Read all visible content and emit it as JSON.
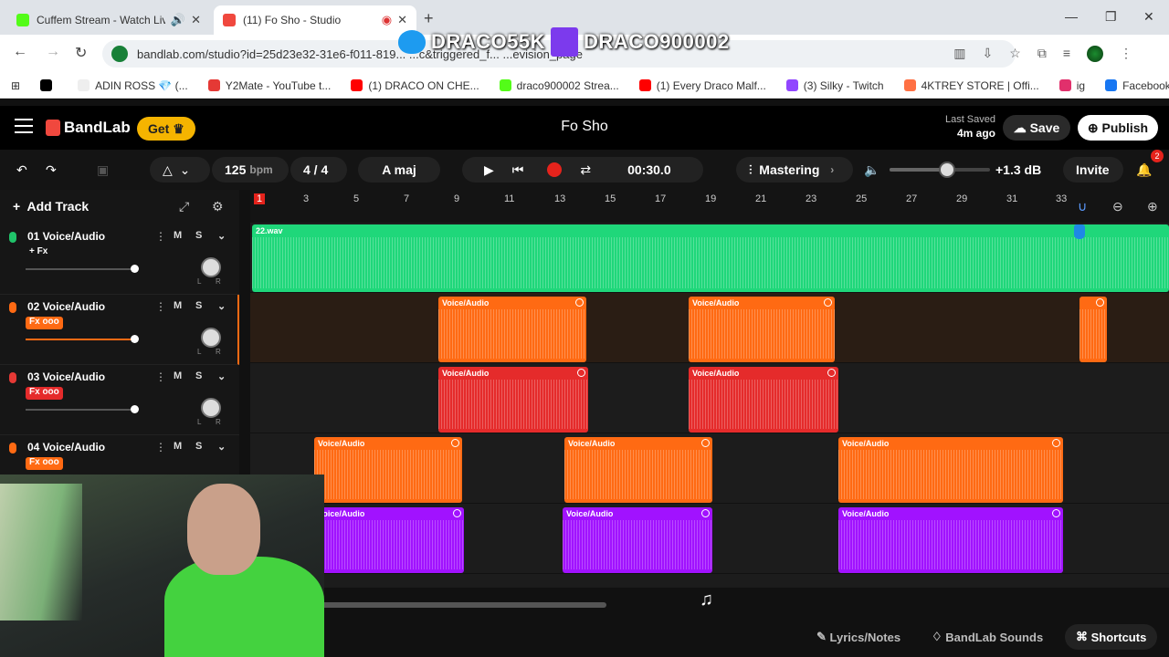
{
  "browser": {
    "tabs": [
      {
        "title": "Cuffem Stream - Watch Live",
        "favicon_color": "#53fc18",
        "state": "inactive"
      },
      {
        "title": "(11) Fo Sho - Studio",
        "favicon_color": "#f0483e",
        "state": "active"
      }
    ],
    "url": "bandlab.com/studio?id=25d23e32-31e6-f011-819... ...c&triggered_f... ...evision_page",
    "bookmarks": [
      {
        "label": "ADIN ROSS 💎 (...",
        "icon_color": "#000000"
      },
      {
        "label": "Y2Mate - YouTube t...",
        "icon_color": "#e53935"
      },
      {
        "label": "(1) DRACO ON CHE...",
        "icon_color": "#ff0000"
      },
      {
        "label": "draco900002 Strea...",
        "icon_color": "#53fc18"
      },
      {
        "label": "(1) Every Draco Malf...",
        "icon_color": "#ff0000"
      },
      {
        "label": "(3) Silky - Twitch",
        "icon_color": "#9146ff"
      },
      {
        "label": "4KTREY STORE | Offi...",
        "icon_color": "#ff7043"
      },
      {
        "label": "ig",
        "icon_color": "#e1306c"
      },
      {
        "label": "Facebook",
        "icon_color": "#1877f2"
      }
    ]
  },
  "overlay": {
    "twitter": "DRACO55K",
    "twitch": "DRACO900002"
  },
  "app": {
    "brand": "BandLab",
    "get_label": "Get",
    "song_title": "Fo Sho",
    "last_saved_label": "Last Saved",
    "last_saved_time": "4m ago",
    "save_label": "Save",
    "publish_label": "Publish"
  },
  "toolbar": {
    "bpm": "125",
    "bpm_unit": "bpm",
    "time_sig": "4 / 4",
    "key": "A maj",
    "time": "00:30.0",
    "mastering": "Mastering",
    "gain": "+1.3 dB",
    "invite": "Invite",
    "notifications": "2",
    "volume_level": 0.55
  },
  "tracks_panel": {
    "add_track": "Add Track",
    "tracks": [
      {
        "name": "01 Voice/Audio",
        "fx": "+ Fx",
        "mic_color": "#20c36a"
      },
      {
        "name": "02 Voice/Audio",
        "fx": "Fx ooo",
        "mic_color": "#ff6a13"
      },
      {
        "name": "03 Voice/Audio",
        "fx": "Fx ooo",
        "mic_color": "#e53935"
      },
      {
        "name": "04 Voice/Audio",
        "fx": "Fx ooo",
        "mic_color": "#ff6a13"
      }
    ],
    "mute": "M",
    "solo": "S"
  },
  "ruler": [
    "1",
    "3",
    "5",
    "7",
    "9",
    "11",
    "13",
    "15",
    "17",
    "19",
    "21",
    "23",
    "25",
    "27",
    "29",
    "31",
    "33"
  ],
  "clips": {
    "file_label": "22.wav",
    "clip_label": "Voice/Audio",
    "colors": {
      "green": "#1fd77a",
      "orange": "#ff6a13",
      "red": "#e52b2b",
      "purple": "#a112ff"
    }
  },
  "bottom": {
    "lyrics": "Lyrics/Notes",
    "sounds": "BandLab Sounds",
    "shortcuts": "Shortcuts"
  }
}
